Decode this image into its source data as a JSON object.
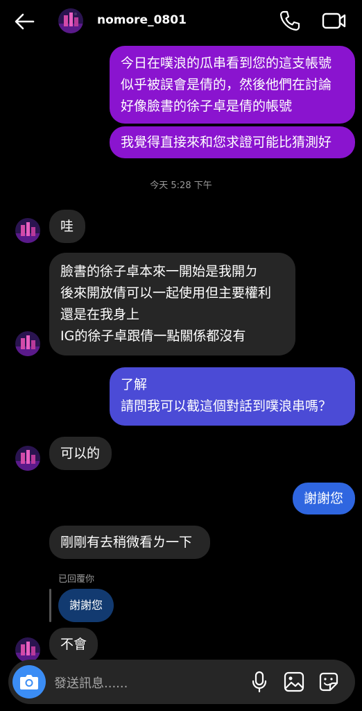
{
  "header": {
    "username": "nomore_0801",
    "back_icon": "back-arrow-icon",
    "call_icon": "phone-icon",
    "video_icon": "video-camera-icon"
  },
  "messages": [
    {
      "text": "今日在噗浪的瓜串看到您的這支帳號\n似乎被誤會是倩的，然後他們在討論\n好像臉書的徐子卓是倩的帳號"
    },
    {
      "text": "我覺得直接來和您求證可能比猜測好"
    },
    {
      "text": "哇"
    },
    {
      "text": "臉書的徐子卓本來一開始是我開ㄉ\n後來開放倩可以一起使用但主要權利\n還是在我身上\nIG的徐子卓跟倩一點關係都沒有"
    },
    {
      "text": "了解\n請問我可以截這個對話到噗浪串嗎？"
    },
    {
      "text": "可以的"
    },
    {
      "text": "謝謝您"
    },
    {
      "text": "剛剛有去稍微看ㄌ一下"
    },
    {
      "text": "不會"
    }
  ],
  "timestamp": "今天 5:28 下午",
  "reply": {
    "label": "已回覆你",
    "quoted": "謝謝您"
  },
  "composer": {
    "placeholder": "發送訊息......",
    "camera_icon": "camera-icon",
    "mic_icon": "microphone-icon",
    "gallery_icon": "image-gallery-icon",
    "sticker_icon": "sticker-icon"
  },
  "colors": {
    "background": "#000000",
    "sent_purple": "#8a14cf",
    "sent_blue": "#4b4bd6",
    "sent_blue_bright": "#2f66e0",
    "received": "#262626",
    "camera_button": "#3b8df5",
    "reply_bubble": "#123a70"
  }
}
